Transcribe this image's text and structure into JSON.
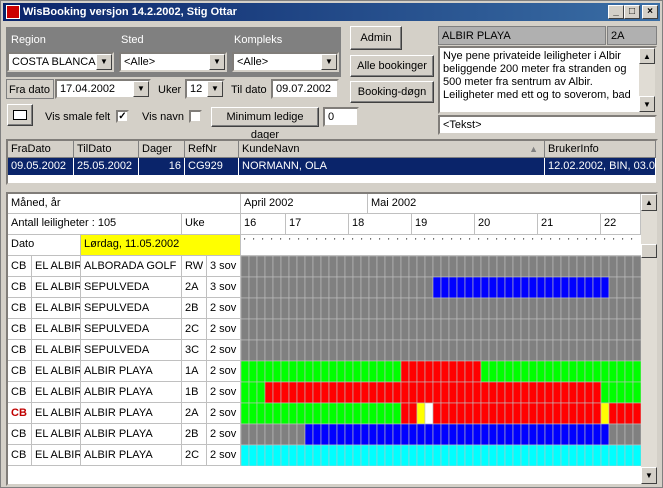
{
  "window": {
    "title": "WisBooking versjon 14.2.2002, Stig Ottar"
  },
  "filters": {
    "region_label": "Region",
    "region_value": "COSTA BLANCA",
    "sted_label": "Sted",
    "sted_value": "<Alle>",
    "kompleks_label": "Kompleks",
    "kompleks_value": "<Alle>",
    "fra_dato_label": "Fra dato",
    "fra_dato_value": "17.04.2002",
    "uker_label": "Uker",
    "uker_value": "12",
    "til_dato_label": "Til dato",
    "til_dato_value": "09.07.2002",
    "vis_smale_label": "Vis smale felt",
    "vis_smale_checked": "✓",
    "vis_navn_label": "Vis navn",
    "min_ledige_label": "Minimum ledige dager",
    "min_ledige_value": "0"
  },
  "buttons": {
    "admin": "Admin",
    "alle_bookinger": "Alle bookinger",
    "booking_dogn": "Booking-døgn"
  },
  "info": {
    "name": "ALBIR PLAYA",
    "code": "2A",
    "description": "Nye pene privateide leiligheter i Albir beliggende 200 meter fra stranden og 500 meter fra sentrum av Albir. Leiligheter med ett og to soverom, bad",
    "tekst": "<Tekst>"
  },
  "booking_table": {
    "headers": [
      "FraDato",
      "TilDato",
      "Dager",
      "RefNr",
      "KundeNavn",
      "BrukerInfo"
    ],
    "row": [
      "09.05.2002",
      "25.05.2002",
      "16",
      "CG929",
      "NORMANN, OLA",
      "12.02.2002, BIN, 03.05"
    ]
  },
  "calendar": {
    "month_year_label": "Måned, år",
    "months": [
      "April 2002",
      "Mai 2002"
    ],
    "antall_label": "Antall leiligheter : 105",
    "uke_label": "Uke",
    "weeks": [
      "16",
      "17",
      "18",
      "19",
      "20",
      "21",
      "22"
    ],
    "dato_label": "Dato",
    "current_date": "Lørdag, 11.05.2002",
    "rows": [
      {
        "area": "CB",
        "sted": "EL ALBIR",
        "kompleks": "ALBORADA GOLF",
        "nr": "RW",
        "type": "3 sov"
      },
      {
        "area": "CB",
        "sted": "EL ALBIR",
        "kompleks": "SEPULVEDA",
        "nr": "2A",
        "type": "3 sov"
      },
      {
        "area": "CB",
        "sted": "EL ALBIR",
        "kompleks": "SEPULVEDA",
        "nr": "2B",
        "type": "2 sov"
      },
      {
        "area": "CB",
        "sted": "EL ALBIR",
        "kompleks": "SEPULVEDA",
        "nr": "2C",
        "type": "2 sov"
      },
      {
        "area": "CB",
        "sted": "EL ALBIR",
        "kompleks": "SEPULVEDA",
        "nr": "3C",
        "type": "2 sov"
      },
      {
        "area": "CB",
        "sted": "EL ALBIR",
        "kompleks": "ALBIR PLAYA",
        "nr": "1A",
        "type": "2 sov"
      },
      {
        "area": "CB",
        "sted": "EL ALBIR",
        "kompleks": "ALBIR PLAYA",
        "nr": "1B",
        "type": "2 sov"
      },
      {
        "area": "CB",
        "sted": "EL ALBIR",
        "kompleks": "ALBIR PLAYA",
        "nr": "2A",
        "type": "2 sov"
      },
      {
        "area": "CB",
        "sted": "EL ALBIR",
        "kompleks": "ALBIR PLAYA",
        "nr": "2B",
        "type": "2 sov"
      },
      {
        "area": "CB",
        "sted": "EL ALBIR",
        "kompleks": "ALBIR PLAYA",
        "nr": "2C",
        "type": "2 sov"
      }
    ],
    "status_colors": {
      "unavailable": "#808080",
      "free": "#00ff00",
      "booked": "#ff0000",
      "own": "#0000ff",
      "partial": "#ffff00",
      "empty": "#ffffff",
      "cyan": "#00ffff"
    },
    "occupancy": [
      "GGGGGGGGGGGGGGGGGGGGGGGGGGGGGGGGGGGGGGGGGGGGGGGGGG",
      "GGGGGGGGGGGGGGGGGGGGGGGGBBBBBBBBBBBBBBBBBBBBBBGGGG",
      "GGGGGGGGGGGGGGGGGGGGGGGGGGGGGGGGGGGGGGGGGGGGGGGGGG",
      "GGGGGGGGGGGGGGGGGGGGGGGGGGGGGGGGGGGGGGGGGGGGGGGGGG",
      "GGGGGGGGGGGGGGGGGGGGGGGGGGGGGGGGGGGGGGGGGGGGGGGGGG",
      "FFFFFFFFFFFFFFFFFFFFRRRRRRRRRRFFFFFFFFFFFFFFFFFFFF",
      "FFFRRRRRRRRRRRRRRRRRRRRRRRRRRRRRRRRRRRRRRRRRRFFFFF",
      "FFFFFFFFFFFFFFFFFFFFRRYWRRRRRRRRRRRRRRRRRRRRRYRRRR",
      "GGGGGGGGBBBBBBBBBBBBBBBBBBBBBBBBBBBBBBBBBBBBBBGGGG",
      "CCCCCCCCCCCCCCCCCCCCCCCCCCCCCCCCCCCCCCCCCCCCCCCCCC"
    ]
  }
}
